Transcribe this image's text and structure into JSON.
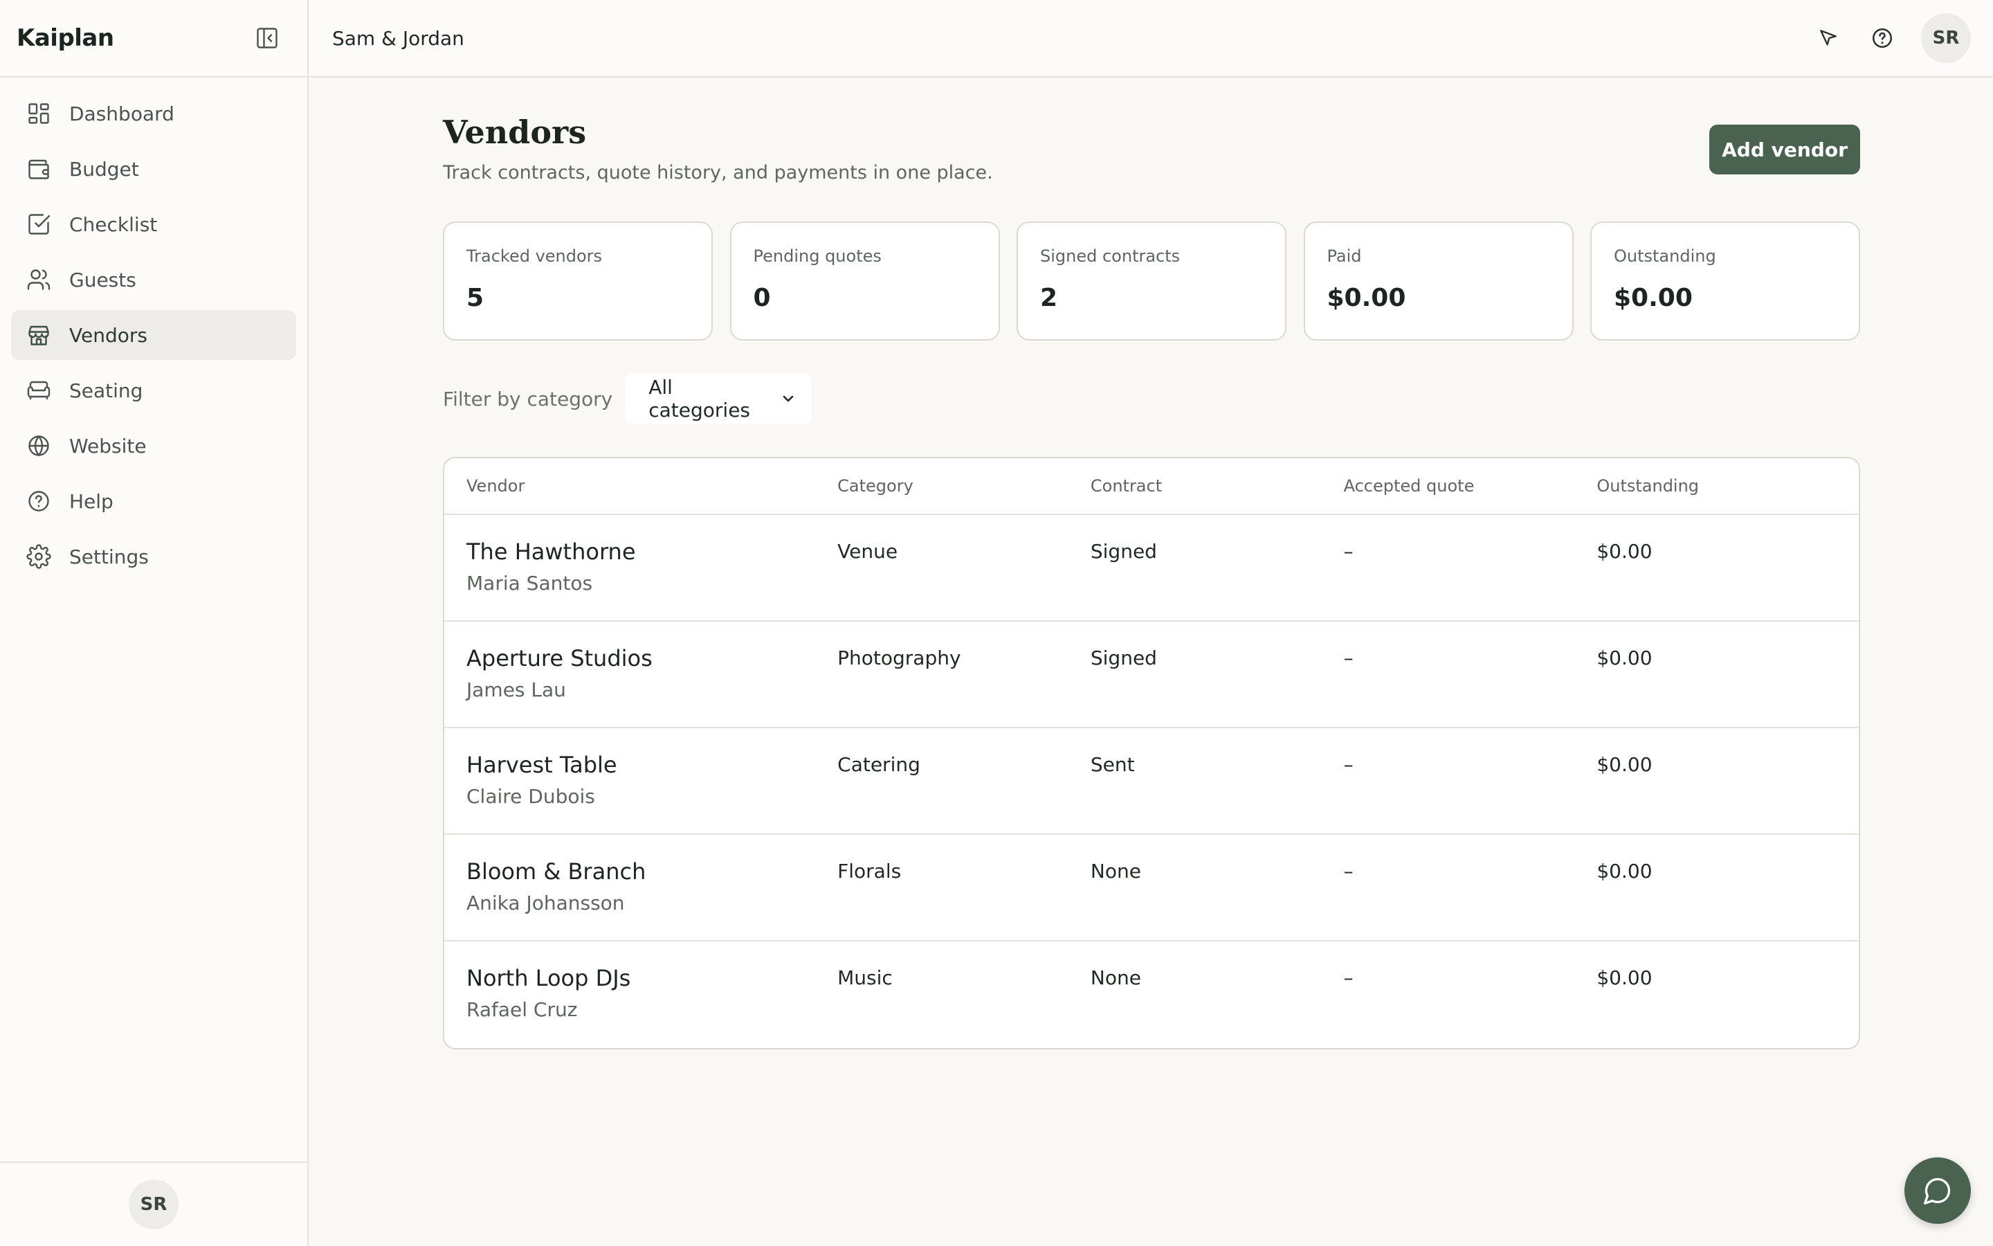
{
  "app": {
    "brand": "Kaiplan",
    "workspace": "Sam & Jordan",
    "user_initials": "SR"
  },
  "sidebar": {
    "items": [
      {
        "label": "Dashboard",
        "icon": "dashboard-icon",
        "active": false
      },
      {
        "label": "Budget",
        "icon": "wallet-icon",
        "active": false
      },
      {
        "label": "Checklist",
        "icon": "checkbox-icon",
        "active": false
      },
      {
        "label": "Guests",
        "icon": "users-icon",
        "active": false
      },
      {
        "label": "Vendors",
        "icon": "store-icon",
        "active": true
      },
      {
        "label": "Seating",
        "icon": "sofa-icon",
        "active": false
      },
      {
        "label": "Website",
        "icon": "globe-icon",
        "active": false
      },
      {
        "label": "Help",
        "icon": "help-icon",
        "active": false
      },
      {
        "label": "Settings",
        "icon": "gear-icon",
        "active": false
      }
    ]
  },
  "page": {
    "title": "Vendors",
    "subtitle": "Track contracts, quote history, and payments in one place.",
    "add_label": "Add vendor"
  },
  "stats": [
    {
      "label": "Tracked vendors",
      "value": "5"
    },
    {
      "label": "Pending quotes",
      "value": "0"
    },
    {
      "label": "Signed contracts",
      "value": "2"
    },
    {
      "label": "Paid",
      "value": "$0.00"
    },
    {
      "label": "Outstanding",
      "value": "$0.00"
    }
  ],
  "filter": {
    "label": "Filter by category",
    "selected": "All categories"
  },
  "table": {
    "headers": [
      "Vendor",
      "Category",
      "Contract",
      "Accepted quote",
      "Outstanding"
    ],
    "rows": [
      {
        "name": "The Hawthorne",
        "contact": "Maria Santos",
        "category": "Venue",
        "contract": "Signed",
        "quote": "–",
        "outstanding": "$0.00"
      },
      {
        "name": "Aperture Studios",
        "contact": "James Lau",
        "category": "Photography",
        "contract": "Signed",
        "quote": "–",
        "outstanding": "$0.00"
      },
      {
        "name": "Harvest Table",
        "contact": "Claire Dubois",
        "category": "Catering",
        "contract": "Sent",
        "quote": "–",
        "outstanding": "$0.00"
      },
      {
        "name": "Bloom & Branch",
        "contact": "Anika Johansson",
        "category": "Florals",
        "contract": "None",
        "quote": "–",
        "outstanding": "$0.00"
      },
      {
        "name": "North Loop DJs",
        "contact": "Rafael Cruz",
        "category": "Music",
        "contract": "None",
        "quote": "–",
        "outstanding": "$0.00"
      }
    ]
  },
  "colors": {
    "accent": "#4a6250",
    "active_bg": "#eeece8",
    "border": "#dcd9d2"
  }
}
